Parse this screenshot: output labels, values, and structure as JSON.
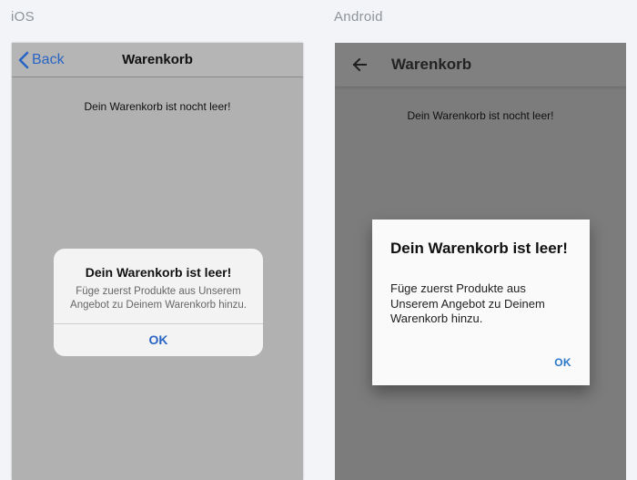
{
  "labels": {
    "ios": "iOS",
    "android": "Android"
  },
  "ios": {
    "back_label": "Back",
    "title": "Warenkorb",
    "empty_text": "Dein Warenkorb ist nocht leer!",
    "alert": {
      "title": "Dein Warenkorb ist leer!",
      "message": "Füge zuerst Produkte aus Unserem Angebot zu Deinem Warenkorb hinzu.",
      "ok_label": "OK"
    },
    "accent_color": "#2965c4",
    "back_icon": "chevron-left-icon"
  },
  "android": {
    "title": "Warenkorb",
    "empty_text": "Dein Warenkorb ist nocht leer!",
    "dialog": {
      "title": "Dein Warenkorb ist leer!",
      "message": "Füge zuerst Produkte aus Unserem Angebot zu Deinem Warenkorb hinzu.",
      "ok_label": "OK"
    },
    "accent_color": "#2a78c9",
    "back_icon": "arrow-left-icon"
  }
}
